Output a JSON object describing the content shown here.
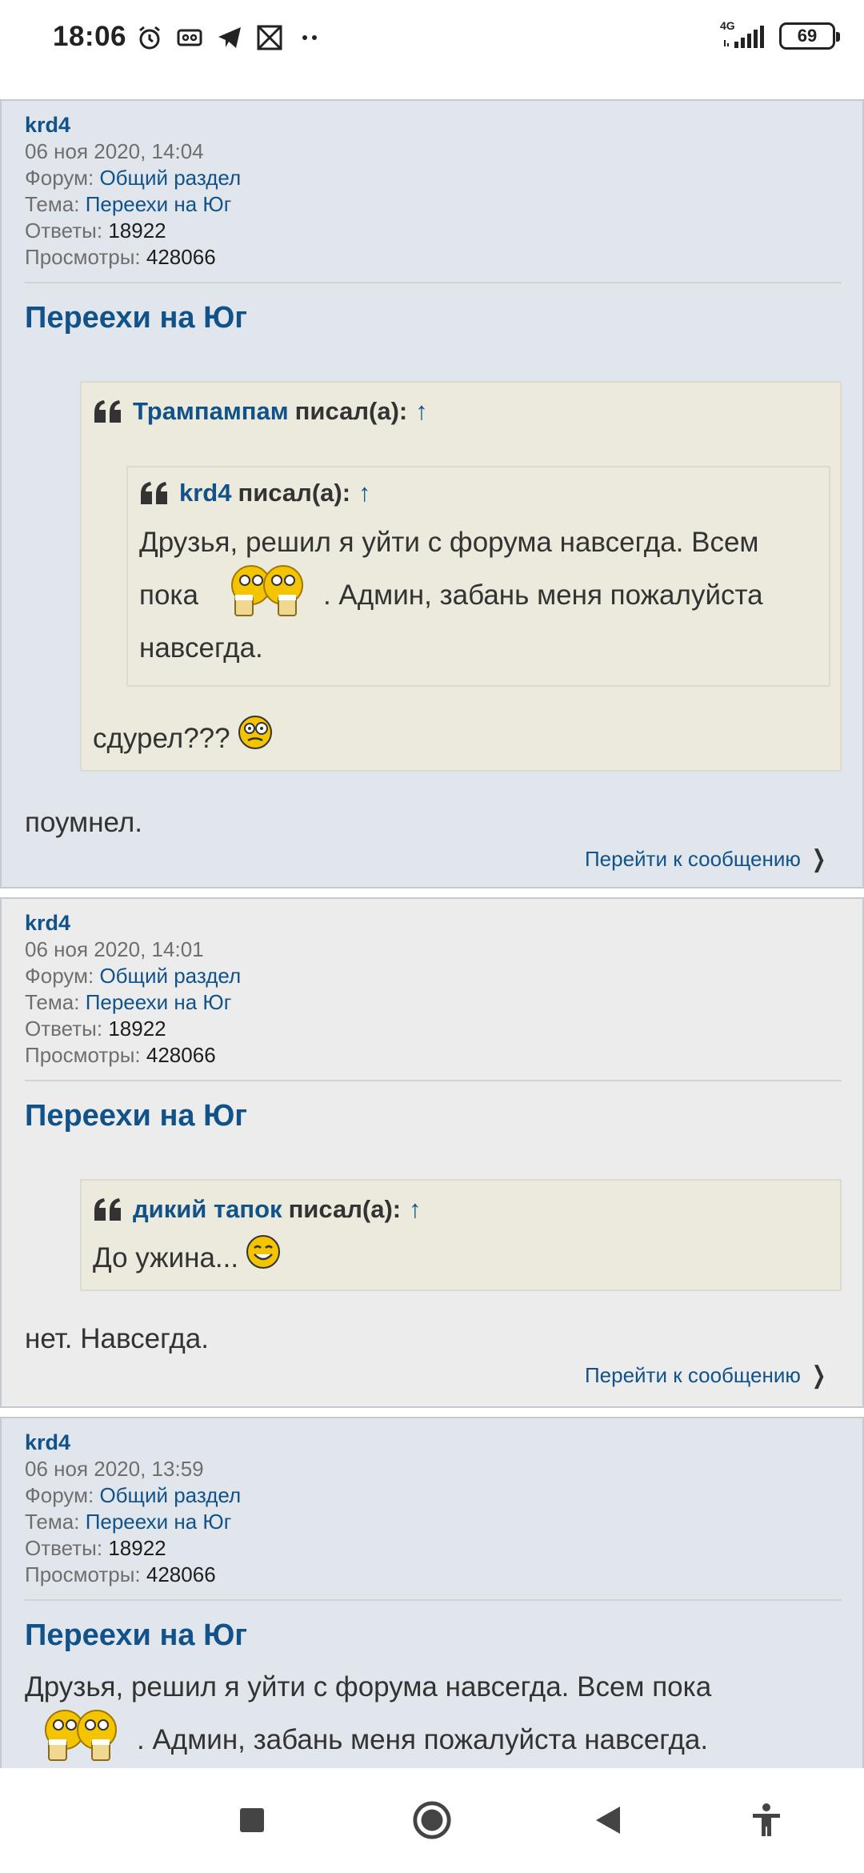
{
  "status_bar": {
    "time": "18:06",
    "left_icons": [
      "alarm-icon",
      "voicemail-icon",
      "telegram-icon",
      "gallery-icon",
      "more-dots-icon"
    ],
    "network": "4G",
    "battery": "69"
  },
  "posts": [
    {
      "author": "krd4",
      "date": "06 ноя 2020, 14:04",
      "forum_label": "Форум:",
      "forum": "Общий раздел",
      "topic_label": "Тема:",
      "topic": "Переехи на Юг",
      "replies_label": "Ответы:",
      "replies": "18922",
      "views_label": "Просмотры:",
      "views": "428066",
      "title": "Переехи на Юг",
      "quote": {
        "author": "Трампампам",
        "wrote": "писал(а):",
        "arrow": "↑",
        "inner_quote": {
          "author": "krd4",
          "wrote": "писал(а):",
          "arrow": "↑",
          "text_1": "Друзья, решил я уйти с форума навсегда. Всем",
          "text_2a": "пока",
          "text_2b": ". Админ, забань меня пожалуйста",
          "text_3": "навсегда."
        },
        "text": "сдурел???"
      },
      "text": "поумнел.",
      "goto": "Перейти к сообщению"
    },
    {
      "author": "krd4",
      "date": "06 ноя 2020, 14:01",
      "forum_label": "Форум:",
      "forum": "Общий раздел",
      "topic_label": "Тема:",
      "topic": "Переехи на Юг",
      "replies_label": "Ответы:",
      "replies": "18922",
      "views_label": "Просмотры:",
      "views": "428066",
      "title": "Переехи на Юг",
      "quote": {
        "author": "дикий тапок",
        "wrote": "писал(а):",
        "arrow": "↑",
        "text": "До ужина..."
      },
      "text": "нет. Навсегда.",
      "goto": "Перейти к сообщению"
    },
    {
      "author": "krd4",
      "date": "06 ноя 2020, 13:59",
      "forum_label": "Форум:",
      "forum": "Общий раздел",
      "topic_label": "Тема:",
      "topic": "Переехи на Юг",
      "replies_label": "Ответы:",
      "replies": "18922",
      "views_label": "Просмотры:",
      "views": "428066",
      "title": "Переехи на Юг",
      "text_1": "Друзья, решил я уйти с форума навсегда. Всем пока",
      "text_2": ". Админ, забань меня пожалуйста навсегда."
    }
  ],
  "nav_bar": {
    "buttons": [
      "recents-square-icon",
      "home-circle-icon",
      "back-triangle-icon",
      "accessibility-icon"
    ]
  },
  "colors": {
    "link": "#105289",
    "post_bg_a": "#e1e6ec",
    "post_bg_b": "#ececec",
    "quote_bg": "#ebeadd",
    "page_active": "#4c93c8"
  }
}
